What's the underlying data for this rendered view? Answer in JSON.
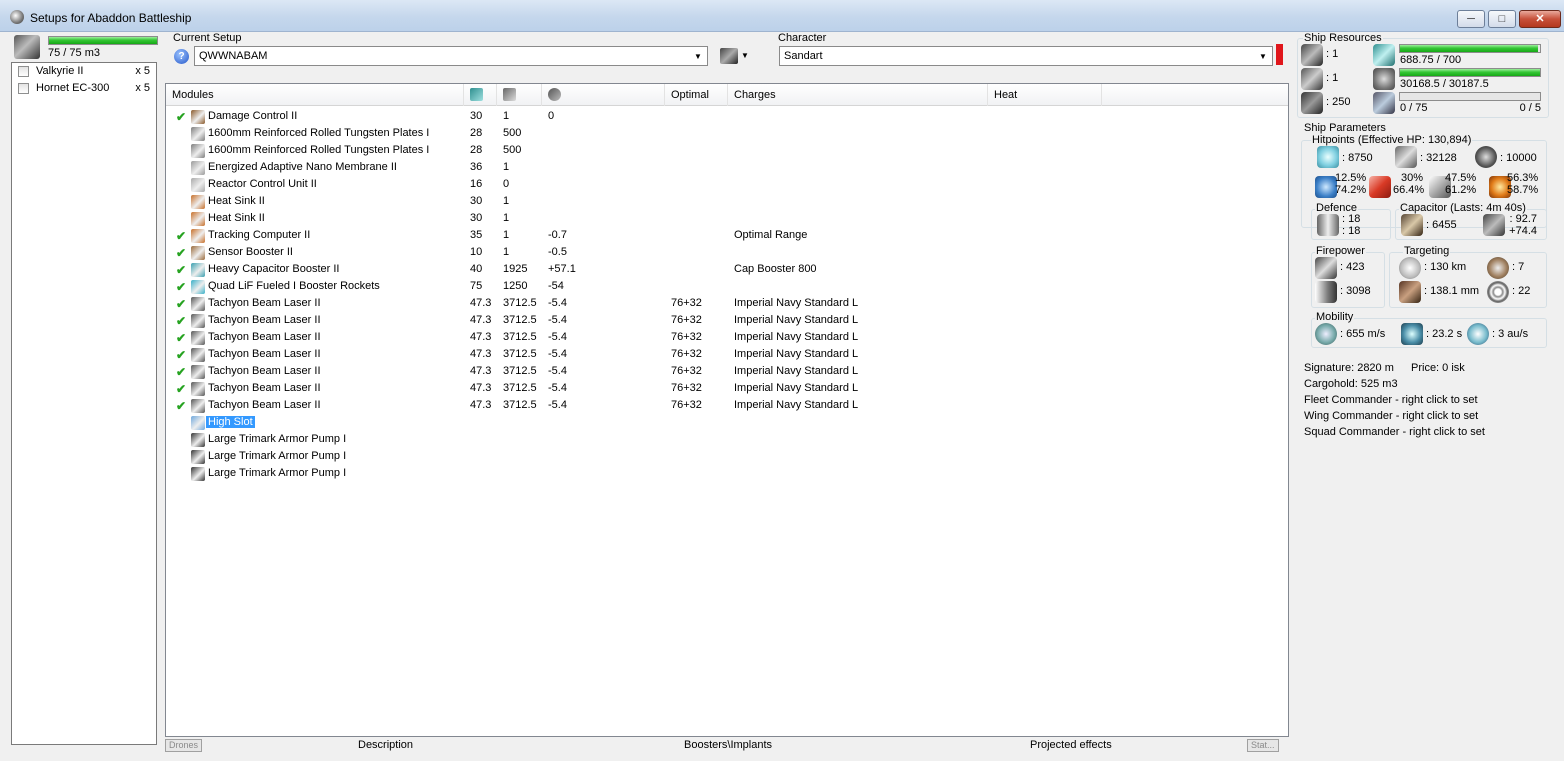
{
  "window": {
    "title": "Setups for Abaddon Battleship",
    "min": "─",
    "max": "□",
    "close": "✕"
  },
  "drone_bay": {
    "usage_text": "75 / 75 m3",
    "usage_fraction": 1.0,
    "drones": [
      {
        "name": "Valkyrie II",
        "qty": "x 5"
      },
      {
        "name": "Hornet EC-300",
        "qty": "x 5"
      }
    ]
  },
  "setup": {
    "label": "Current Setup",
    "value": "QWWNABAM",
    "help": "?"
  },
  "character": {
    "label": "Character",
    "value": "Sandart"
  },
  "columns": {
    "modules": "Modules",
    "optimal": "Optimal",
    "charges": "Charges",
    "heat": "Heat"
  },
  "modules": [
    {
      "check": "✔",
      "name": "Damage Control II",
      "pg": "30",
      "cpu": "1",
      "cap": "0",
      "opt": "",
      "charge": "",
      "icon": "damage-control-icon",
      "color": "#8a5a2b"
    },
    {
      "check": "",
      "name": "1600mm Reinforced Rolled Tungsten Plates I",
      "pg": "28",
      "cpu": "500",
      "cap": "",
      "opt": "",
      "charge": "",
      "icon": "armor-plate-icon",
      "color": "#7d7d7d"
    },
    {
      "check": "",
      "name": "1600mm Reinforced Rolled Tungsten Plates I",
      "pg": "28",
      "cpu": "500",
      "cap": "",
      "opt": "",
      "charge": "",
      "icon": "armor-plate-icon",
      "color": "#7d7d7d"
    },
    {
      "check": "",
      "name": "Energized Adaptive Nano Membrane II",
      "pg": "36",
      "cpu": "1",
      "cap": "",
      "opt": "",
      "charge": "",
      "icon": "membrane-icon",
      "color": "#9a9a9a"
    },
    {
      "check": "",
      "name": "Reactor Control Unit II",
      "pg": "16",
      "cpu": "0",
      "cap": "",
      "opt": "",
      "charge": "",
      "icon": "reactor-icon",
      "color": "#a9a9a9"
    },
    {
      "check": "",
      "name": "Heat Sink II",
      "pg": "30",
      "cpu": "1",
      "cap": "",
      "opt": "",
      "charge": "",
      "icon": "heat-sink-icon",
      "color": "#c8702a"
    },
    {
      "check": "",
      "name": "Heat Sink II",
      "pg": "30",
      "cpu": "1",
      "cap": "",
      "opt": "",
      "charge": "",
      "icon": "heat-sink-icon",
      "color": "#c8702a"
    },
    {
      "check": "✔",
      "name": "Tracking Computer II",
      "pg": "35",
      "cpu": "1",
      "cap": "-0.7",
      "opt": "",
      "charge": "Optimal Range",
      "icon": "tracking-computer-icon",
      "color": "#c8702a"
    },
    {
      "check": "✔",
      "name": "Sensor Booster II",
      "pg": "10",
      "cpu": "1",
      "cap": "-0.5",
      "opt": "",
      "charge": "",
      "icon": "sensor-booster-icon",
      "color": "#9a6a3a"
    },
    {
      "check": "✔",
      "name": "Heavy Capacitor Booster II",
      "pg": "40",
      "cpu": "1925",
      "cap": "+57.1",
      "opt": "",
      "charge": "Cap Booster 800",
      "icon": "cap-booster-icon",
      "color": "#3aa0b0"
    },
    {
      "check": "✔",
      "name": "Quad LiF Fueled I Booster Rockets",
      "pg": "75",
      "cpu": "1250",
      "cap": "-54",
      "opt": "",
      "charge": "",
      "icon": "booster-rocket-icon",
      "color": "#3ab0c8"
    },
    {
      "check": "✔",
      "name": "Tachyon Beam Laser II",
      "pg": "47.3",
      "cpu": "3712.5",
      "cap": "-5.4",
      "opt": "76+32",
      "charge": "Imperial Navy Standard L",
      "icon": "laser-icon",
      "color": "#555555"
    },
    {
      "check": "✔",
      "name": "Tachyon Beam Laser II",
      "pg": "47.3",
      "cpu": "3712.5",
      "cap": "-5.4",
      "opt": "76+32",
      "charge": "Imperial Navy Standard L",
      "icon": "laser-icon",
      "color": "#555555"
    },
    {
      "check": "✔",
      "name": "Tachyon Beam Laser II",
      "pg": "47.3",
      "cpu": "3712.5",
      "cap": "-5.4",
      "opt": "76+32",
      "charge": "Imperial Navy Standard L",
      "icon": "laser-icon",
      "color": "#555555"
    },
    {
      "check": "✔",
      "name": "Tachyon Beam Laser II",
      "pg": "47.3",
      "cpu": "3712.5",
      "cap": "-5.4",
      "opt": "76+32",
      "charge": "Imperial Navy Standard L",
      "icon": "laser-icon",
      "color": "#555555"
    },
    {
      "check": "✔",
      "name": "Tachyon Beam Laser II",
      "pg": "47.3",
      "cpu": "3712.5",
      "cap": "-5.4",
      "opt": "76+32",
      "charge": "Imperial Navy Standard L",
      "icon": "laser-icon",
      "color": "#555555"
    },
    {
      "check": "✔",
      "name": "Tachyon Beam Laser II",
      "pg": "47.3",
      "cpu": "3712.5",
      "cap": "-5.4",
      "opt": "76+32",
      "charge": "Imperial Navy Standard L",
      "icon": "laser-icon",
      "color": "#555555"
    },
    {
      "check": "✔",
      "name": "Tachyon Beam Laser II",
      "pg": "47.3",
      "cpu": "3712.5",
      "cap": "-5.4",
      "opt": "76+32",
      "charge": "Imperial Navy Standard L",
      "icon": "laser-icon",
      "color": "#555555"
    },
    {
      "check": "",
      "name": "High Slot",
      "pg": "",
      "cpu": "",
      "cap": "",
      "opt": "",
      "charge": "",
      "icon": "high-slot-icon",
      "color": "#6fa8dc",
      "selected": true
    },
    {
      "check": "",
      "name": "Large Trimark Armor Pump I",
      "pg": "",
      "cpu": "",
      "cap": "",
      "opt": "",
      "charge": "",
      "icon": "rig-icon",
      "color": "#333333"
    },
    {
      "check": "",
      "name": "Large Trimark Armor Pump I",
      "pg": "",
      "cpu": "",
      "cap": "",
      "opt": "",
      "charge": "",
      "icon": "rig-icon",
      "color": "#333333"
    },
    {
      "check": "",
      "name": "Large Trimark Armor Pump I",
      "pg": "",
      "cpu": "",
      "cap": "",
      "opt": "",
      "charge": "",
      "icon": "rig-icon",
      "color": "#333333"
    }
  ],
  "bottom_tabs": {
    "drones": "Drones",
    "description": "Description",
    "boosters": "Boosters\\Implants",
    "projected": "Projected effects",
    "stats": "Stat..."
  },
  "resources": {
    "title": "Ship Resources",
    "turret_slots": ": 1",
    "launcher_slots": ": 1",
    "drone_bandwidth": ": 250",
    "powergrid_text": "688.75 / 700",
    "powergrid_fraction": 0.984,
    "cpu_text": "30168.5 / 30187.5",
    "cpu_fraction": 0.999,
    "calibration_text": "0 / 75",
    "calibration_fraction": 0,
    "calibration_right": "0 / 5"
  },
  "params": {
    "title": "Ship Parameters",
    "hitpoints_title": "Hitpoints (Effective HP: 130,894)",
    "shield_hp": ": 8750",
    "armor_hp": ": 32128",
    "structure_hp": ": 10000",
    "res_em_1": "12.5%",
    "res_em_2": "74.2%",
    "res_th_1": "30%",
    "res_th_2": "66.4%",
    "res_ki_1": "47.5%",
    "res_ki_2": "61.2%",
    "res_ex_1": "56.3%",
    "res_ex_2": "58.7%",
    "defence_title": "Defence",
    "defence_1": ": 18",
    "defence_2": ": 18",
    "capacitor_title": "Capacitor (Lasts: 4m 40s)",
    "capacitor_amount": ": 6455",
    "capacitor_rate_1": ": 92.7",
    "capacitor_rate_2": "+74.4",
    "firepower_title": "Firepower",
    "firepower_dps": ": 423",
    "firepower_volley": ": 3098",
    "targeting_title": "Targeting",
    "target_range": ": 130 km",
    "max_targets": ": 7",
    "scan_res": ": 138.1 mm",
    "sensor_strength": ": 22",
    "mobility_title": "Mobility",
    "speed": ": 655 m/s",
    "align_time": ": 23.2 s",
    "warp_speed": ": 3 au/s",
    "signature": "Signature: 2820 m",
    "price": "Price: 0 isk",
    "cargohold": "Cargohold: 525 m3",
    "fleet_cmd": "Fleet Commander - right click to set",
    "wing_cmd": "Wing Commander - right click to set",
    "squad_cmd": "Squad Commander - right click to set"
  }
}
